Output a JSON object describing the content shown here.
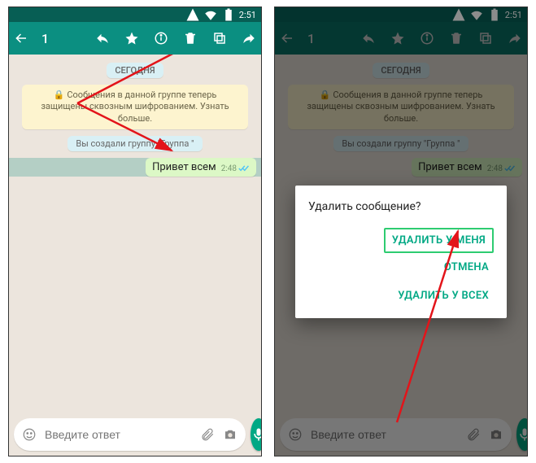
{
  "status": {
    "time": "2:51"
  },
  "appbar": {
    "selection_count": "1"
  },
  "chat": {
    "date_label": "СЕГОДНЯ",
    "encryption_notice": "Сообщения в данной группе теперь защищены сквозным шифрованием. Узнать больше.",
    "system_created": "Вы создали группу \"Группа \"",
    "message": {
      "text": "Привет всем",
      "time": "2:48"
    }
  },
  "input": {
    "placeholder": "Введите ответ"
  },
  "dialog": {
    "title": "Удалить сообщение?",
    "delete_for_me": "УДАЛИТЬ У МЕНЯ",
    "cancel": "ОТМЕНА",
    "delete_for_all": "УДАЛИТЬ У ВСЕХ"
  }
}
